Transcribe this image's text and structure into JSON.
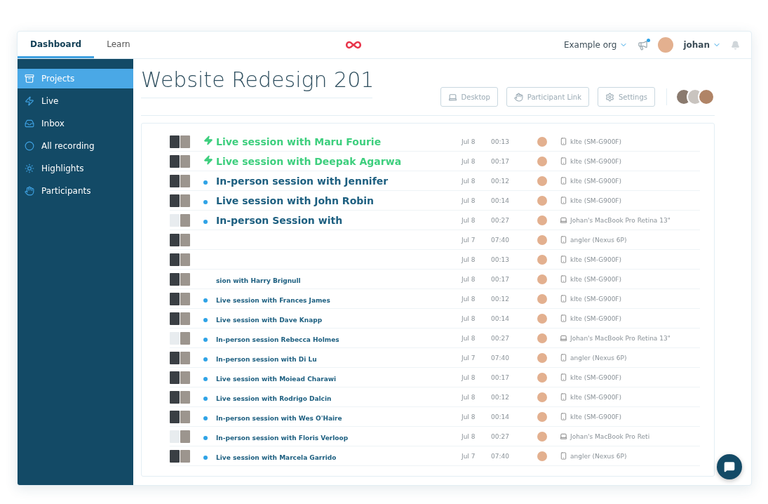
{
  "topbar": {
    "tabs": [
      {
        "label": "Dashboard",
        "selected": true
      },
      {
        "label": "Learn",
        "selected": false
      }
    ],
    "org": "Example org",
    "notification_dot": true,
    "user": "johan"
  },
  "sidebar": {
    "items": [
      {
        "label": "Projects",
        "selected": true
      },
      {
        "label": "Live",
        "selected": false
      },
      {
        "label": "Inbox",
        "selected": false
      },
      {
        "label": "All recording",
        "selected": false
      },
      {
        "label": "Highlights",
        "selected": false
      },
      {
        "label": "Participants",
        "selected": false
      }
    ]
  },
  "project": {
    "title": "Website Redesign 201",
    "buttons": [
      "Desktop",
      "Participant Link",
      "Settings"
    ]
  },
  "sessions": [
    {
      "title": "Live session with Maru Fourie",
      "live": true,
      "magnified": true,
      "date": "Jul 8",
      "duration": "00:13",
      "device": "klte (SM-G900F)",
      "kind": "phone"
    },
    {
      "title": "Live session with Deepak Agarwa",
      "live": true,
      "magnified": true,
      "date": "Jul 8",
      "duration": "00:17",
      "device": "klte (SM-G900F)",
      "kind": "phone"
    },
    {
      "title": "In-person session with Jennifer",
      "live": false,
      "magnified": true,
      "date": "Jul 8",
      "duration": "00:12",
      "device": "klte (SM-G900F)",
      "kind": "phone"
    },
    {
      "title": "Live session with John Robin",
      "live": false,
      "magnified": true,
      "date": "Jul 8",
      "duration": "00:14",
      "device": "klte (SM-G900F)",
      "kind": "phone"
    },
    {
      "title": "In-person Session with",
      "live": false,
      "magnified": true,
      "date": "Jul 8",
      "duration": "00:27",
      "device": "Johan's MacBook Pro Retina 13\"",
      "kind": "laptop"
    },
    {
      "date": "Jul 7",
      "duration": "07:40",
      "device": "angler (Nexus 6P)",
      "kind": "phone"
    },
    {
      "date": "Jul 8",
      "duration": "00:13",
      "device": "klte (SM-G900F)",
      "kind": "phone"
    },
    {
      "title": "sion with Harry Brignull",
      "magnified": false,
      "date": "Jul 8",
      "duration": "00:17",
      "device": "klte (SM-G900F)",
      "kind": "phone"
    },
    {
      "title": "Live session with Frances James",
      "live": false,
      "magnified": false,
      "date": "Jul 8",
      "duration": "00:12",
      "device": "klte (SM-G900F)",
      "kind": "phone"
    },
    {
      "title": "Live session with Dave Knapp",
      "live": false,
      "magnified": false,
      "date": "Jul 8",
      "duration": "00:14",
      "device": "klte (SM-G900F)",
      "kind": "phone"
    },
    {
      "title": "In-person session Rebecca Holmes",
      "live": false,
      "magnified": false,
      "date": "Jul 8",
      "duration": "00:27",
      "device": "Johan's MacBook Pro Retina 13\"",
      "kind": "laptop"
    },
    {
      "title": "In-person session with Di Lu",
      "live": false,
      "magnified": false,
      "date": "Jul 7",
      "duration": "07:40",
      "device": "angler (Nexus 6P)",
      "kind": "phone"
    },
    {
      "title": "Live session with Moiead Charawi",
      "live": false,
      "magnified": false,
      "date": "Jul 8",
      "duration": "00:17",
      "device": "klte (SM-G900F)",
      "kind": "phone"
    },
    {
      "title": "Live session with Rodrigo Dalcin",
      "live": false,
      "magnified": false,
      "date": "Jul 8",
      "duration": "00:12",
      "device": "klte (SM-G900F)",
      "kind": "phone"
    },
    {
      "title": "In-person session with Wes O'Haire",
      "live": false,
      "magnified": false,
      "date": "Jul 8",
      "duration": "00:14",
      "device": "klte (SM-G900F)",
      "kind": "phone"
    },
    {
      "title": "In-person session with Floris Verloop",
      "live": false,
      "magnified": false,
      "date": "Jul 8",
      "duration": "00:27",
      "device": "Johan's MacBook Pro Reti",
      "kind": "laptop"
    },
    {
      "title": "Live session with Marcela Garrido",
      "live": false,
      "magnified": false,
      "date": "Jul 7",
      "duration": "07:40",
      "device": "angler (Nexus 6P)",
      "kind": "phone"
    }
  ]
}
